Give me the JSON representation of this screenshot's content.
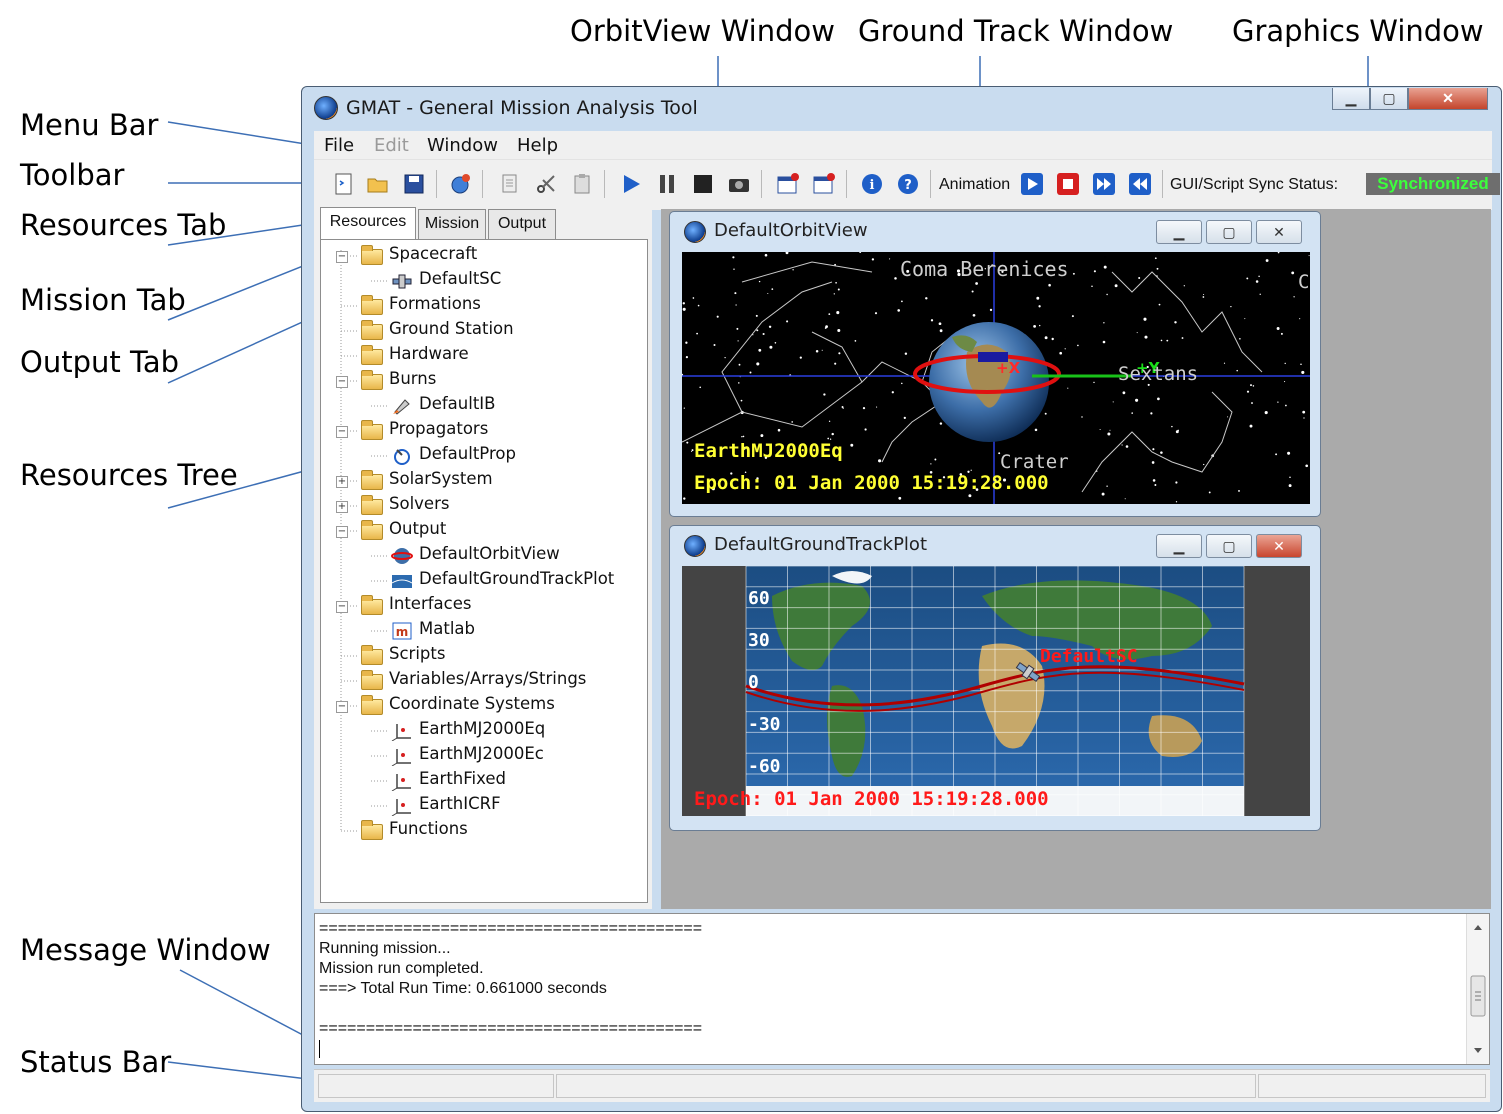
{
  "callouts": {
    "menu_bar": "Menu Bar",
    "toolbar": "Toolbar",
    "resources_tab": "Resources Tab",
    "mission_tab": "Mission Tab",
    "output_tab": "Output Tab",
    "resources_tree": "Resources Tree",
    "message_window": "Message Window",
    "status_bar": "Status Bar",
    "orbitview_window": "OrbitView Window",
    "ground_track_window": "Ground Track Window",
    "graphics_window": "Graphics Window"
  },
  "window": {
    "title": "GMAT - General Mission Analysis Tool",
    "minimize": "▁",
    "maximize": "▢",
    "close": "✕"
  },
  "menu": [
    "File",
    "Edit",
    "Window",
    "Help"
  ],
  "toolbar": {
    "animation_label": "Animation",
    "sync_label": "GUI/Script Sync Status:",
    "sync_value": "Synchronized",
    "sync_color": "#3cff3c"
  },
  "tabs": [
    "Resources",
    "Mission",
    "Output"
  ],
  "tree": [
    {
      "label": "Spacecraft",
      "type": "folder",
      "expanded": true
    },
    {
      "label": "DefaultSC",
      "type": "spacecraft-icon"
    },
    {
      "label": "Formations",
      "type": "folder"
    },
    {
      "label": "Ground Station",
      "type": "folder"
    },
    {
      "label": "Hardware",
      "type": "folder"
    },
    {
      "label": "Burns",
      "type": "folder",
      "expanded": true
    },
    {
      "label": "DefaultIB",
      "type": "burn-icon"
    },
    {
      "label": "Propagators",
      "type": "folder",
      "expanded": true
    },
    {
      "label": "DefaultProp",
      "type": "propagator-icon"
    },
    {
      "label": "SolarSystem",
      "type": "folder",
      "collapsed": true
    },
    {
      "label": "Solvers",
      "type": "folder",
      "collapsed": true
    },
    {
      "label": "Output",
      "type": "folder",
      "expanded": true
    },
    {
      "label": "DefaultOrbitView",
      "type": "orbitview-icon"
    },
    {
      "label": "DefaultGroundTrackPlot",
      "type": "groundtrack-icon"
    },
    {
      "label": "Interfaces",
      "type": "folder",
      "expanded": true
    },
    {
      "label": "Matlab",
      "type": "matlab-icon"
    },
    {
      "label": "Scripts",
      "type": "folder"
    },
    {
      "label": "Variables/Arrays/Strings",
      "type": "folder"
    },
    {
      "label": "Coordinate Systems",
      "type": "folder",
      "expanded": true
    },
    {
      "label": "EarthMJ2000Eq",
      "type": "coord-icon"
    },
    {
      "label": "EarthMJ2000Ec",
      "type": "coord-icon"
    },
    {
      "label": "EarthFixed",
      "type": "coord-icon"
    },
    {
      "label": "EarthICRF",
      "type": "coord-icon"
    },
    {
      "label": "Functions",
      "type": "folder"
    }
  ],
  "orbit_view": {
    "title": "DefaultOrbitView",
    "constellations": [
      "Coma Berenices",
      "Sextans",
      "Crater",
      "C"
    ],
    "axis_x": "+X",
    "axis_y": "+Y",
    "coord_system": "EarthMJ2000Eq",
    "epoch": "Epoch: 01 Jan 2000 15:19:28.000"
  },
  "ground_track": {
    "title": "DefaultGroundTrackPlot",
    "lat_labels": [
      "60",
      "30",
      "0",
      "-30",
      "-60"
    ],
    "spacecraft": "DefaultSC",
    "epoch": "Epoch: 01 Jan 2000 15:19:28.000"
  },
  "messages": [
    "=========================================",
    "Running mission...",
    "Mission run completed.",
    "===> Total Run Time: 0.661000 seconds",
    "",
    "========================================="
  ],
  "colors": {
    "sync_bg": "#6e6e6e",
    "overlay_yellow": "#ffff33",
    "overlay_red": "#ff1a1a",
    "orbit_red": "#e01010"
  }
}
